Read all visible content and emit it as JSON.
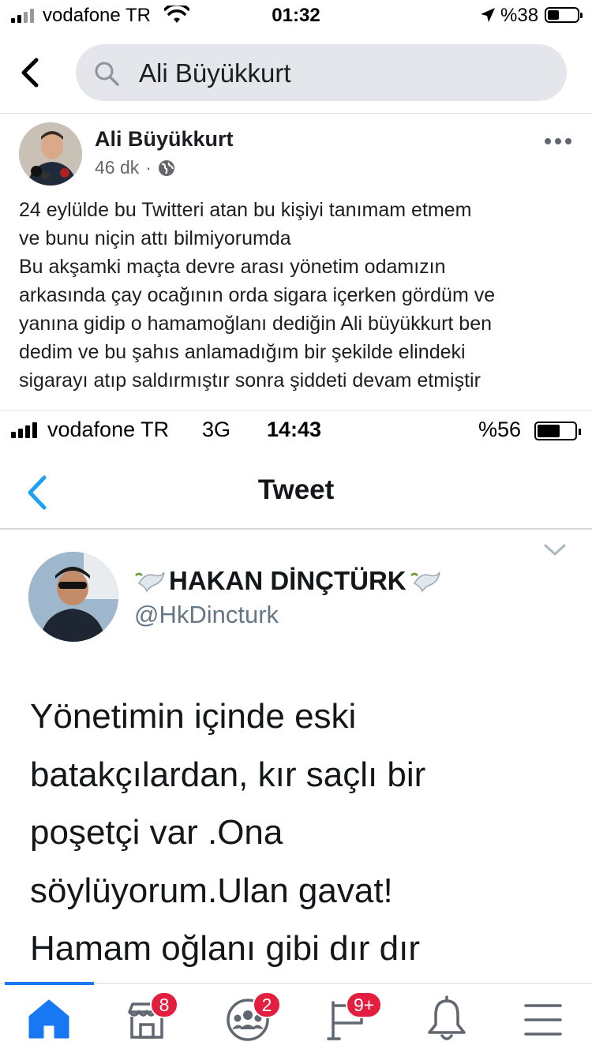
{
  "status_bar": {
    "carrier": "vodafone TR",
    "time": "01:32",
    "battery": "%38",
    "icons": [
      "signal-icon",
      "wifi-icon",
      "location-arrow-icon",
      "battery-icon"
    ]
  },
  "search": {
    "query": "Ali Büyükkurt",
    "icons": [
      "back-chevron-icon",
      "search-icon"
    ]
  },
  "post": {
    "author": "Ali Büyükkurt",
    "time": "46 dk",
    "separator": "·",
    "privacy_icon": "globe-icon",
    "text_lines": [
      "24 eylülde bu Twitteri atan bu kişiyi tanımam etmem",
      "ve bunu niçin attı bilmiyorumda",
      "Bu akşamki maçta devre arası yönetim odamızın",
      "arkasında çay ocağının orda sigara içerken gördüm ve",
      "yanına gidip o hamamoğlanı dediğin Ali büyükkurt ben",
      "dedim ve bu şahıs anlamadığım bir şekilde elindeki",
      "sigarayı atıp saldırmıştır sonra şiddeti devam etmiştir"
    ]
  },
  "screenshot": {
    "status_bar": {
      "carrier": "vodafone TR",
      "network": "3G",
      "time": "14:43",
      "battery": "%56"
    },
    "nav": {
      "title": "Tweet"
    },
    "tweet": {
      "name": "HAKAN DİNÇTÜRK",
      "handle": "@HkDincturk",
      "name_emoji": "dove-of-peace",
      "text_lines": [
        "Yönetimin içinde eski",
        "batakçılardan, kır saçlı bir",
        "poşetçi var .Ona",
        "söylüyorum.Ulan gavat!",
        "Hamam oğlanı gibi dır dır"
      ]
    }
  },
  "tab_bar": {
    "accent": "#1877f2",
    "badge_color": "#e41e3f",
    "tabs": [
      {
        "name": "home",
        "icon": "home-icon",
        "badge": ""
      },
      {
        "name": "marketplace",
        "icon": "store-icon",
        "badge": "8"
      },
      {
        "name": "groups",
        "icon": "groups-icon",
        "badge": "2"
      },
      {
        "name": "pages",
        "icon": "flag-icon",
        "badge": "9+"
      },
      {
        "name": "notifications",
        "icon": "bell-icon",
        "badge": ""
      },
      {
        "name": "menu",
        "icon": "hamburger-menu-icon",
        "badge": ""
      }
    ]
  }
}
